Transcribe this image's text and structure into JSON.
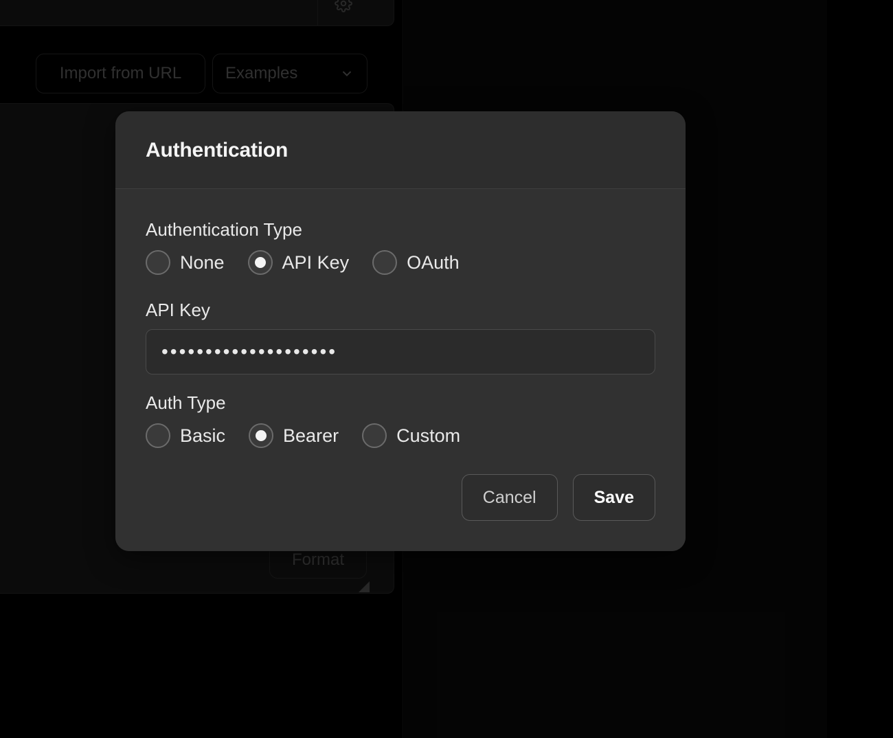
{
  "background": {
    "import_label": "Import from URL",
    "examples_label": "Examples",
    "format_label": "Format"
  },
  "modal": {
    "title": "Authentication",
    "auth_type_label": "Authentication Type",
    "auth_type_options": {
      "none": "None",
      "api_key": "API Key",
      "oauth": "OAuth"
    },
    "auth_type_selected": "api_key",
    "api_key_label": "API Key",
    "api_key_value": "••••••••••••••••••••",
    "auth_scheme_label": "Auth Type",
    "auth_scheme_options": {
      "basic": "Basic",
      "bearer": "Bearer",
      "custom": "Custom"
    },
    "auth_scheme_selected": "bearer",
    "cancel_label": "Cancel",
    "save_label": "Save"
  }
}
